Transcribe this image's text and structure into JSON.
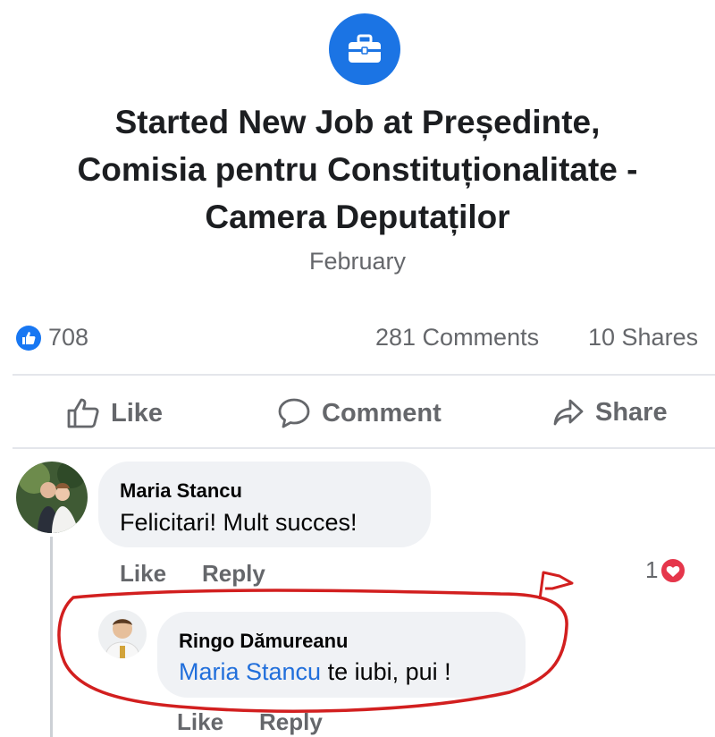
{
  "event": {
    "icon": "briefcase-icon",
    "title_line1": "Started New Job at Președinte,",
    "title_line2": "Comisia pentru Constituționalitate -",
    "title_line3": "Camera Deputaților",
    "date": "February"
  },
  "stats": {
    "reactions_count": "708",
    "comments_count": "281 Comments",
    "shares_count": "10 Shares"
  },
  "actions": {
    "like_label": "Like",
    "comment_label": "Comment",
    "share_label": "Share"
  },
  "comments": [
    {
      "author": "Maria Stancu",
      "text": "Felicitari! Mult succes!",
      "like_label": "Like",
      "reply_label": "Reply",
      "reaction_count": "1",
      "reaction_icon": "heart-icon"
    }
  ],
  "reply": {
    "author": "Ringo Dămureanu",
    "mention": "Maria Stancu",
    "text": " te iubi, pui !",
    "like_label": "Like",
    "reply_label": "Reply"
  },
  "colors": {
    "accent": "#1b74e4",
    "annotation": "#d21f1f",
    "heart": "#e5364b"
  }
}
